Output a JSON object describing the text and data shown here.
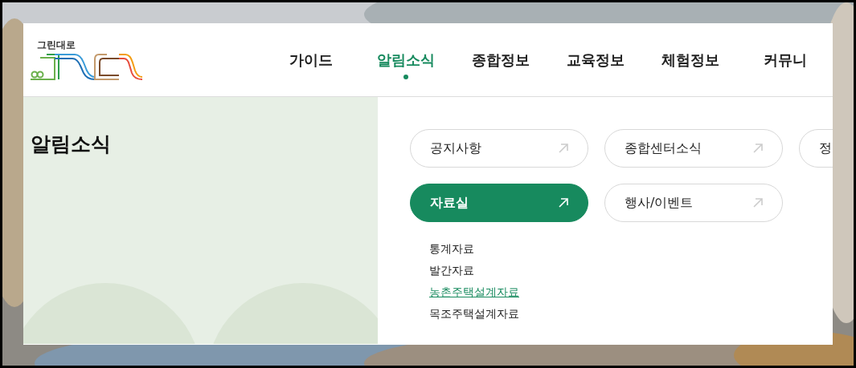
{
  "logo": {
    "text": "그린대로"
  },
  "nav": [
    {
      "label": "가이드",
      "selected": false
    },
    {
      "label": "알림소식",
      "selected": true
    },
    {
      "label": "종합정보",
      "selected": false
    },
    {
      "label": "교육정보",
      "selected": false
    },
    {
      "label": "체험정보",
      "selected": false
    },
    {
      "label": "커뮤니",
      "selected": false
    }
  ],
  "section_title": "알림소식",
  "menu": [
    {
      "label": "공지사항",
      "selected": false
    },
    {
      "label": "종합센터소식",
      "selected": false
    },
    {
      "label": "정",
      "selected": false,
      "clipped": true
    },
    {
      "label": "자료실",
      "selected": true,
      "children": [
        {
          "label": "통계자료",
          "selected": false
        },
        {
          "label": "발간자료",
          "selected": false
        },
        {
          "label": "농촌주택설계자료",
          "selected": true
        },
        {
          "label": "목조주택설계자료",
          "selected": false
        }
      ]
    },
    {
      "label": "행사/이벤트",
      "selected": false
    }
  ]
}
